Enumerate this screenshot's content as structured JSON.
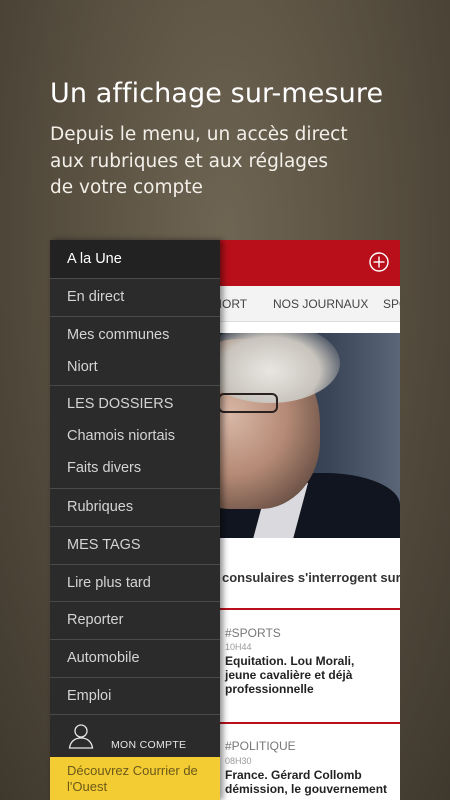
{
  "promo": {
    "title": "Un affichage sur-mesure",
    "subtitle_lines": [
      "Depuis le menu, un accès direct",
      "aux rubriques et aux réglages",
      "de votre compte"
    ]
  },
  "app": {
    "tabs": [
      "NIORT",
      "NOS JOURNAUX",
      "SPO"
    ],
    "lead_story": "consulaires s'interrogent sur",
    "cards": [
      {
        "tag": "#SPORTS",
        "time": "10H44",
        "title_lines": [
          "Equitation. Lou Morali,",
          "jeune cavalière et déjà",
          "professionnelle"
        ]
      },
      {
        "tag": "#POLITIQUE",
        "time": "08H30",
        "title_lines": [
          "France. Gérard Collomb",
          "démission, le gouvernement"
        ]
      }
    ],
    "colors": {
      "header": "#b90f1a",
      "drawer": "#2b2b2b",
      "cta": "#f3cb32"
    },
    "header_icon": "plus-circle-icon"
  },
  "drawer": {
    "items": [
      {
        "label": "A la Une",
        "active": true
      },
      {
        "label": "En direct"
      },
      {
        "label": "Mes communes"
      },
      {
        "label": "Niort"
      },
      {
        "label": "LES DOSSIERS"
      },
      {
        "label": "Chamois niortais"
      },
      {
        "label": "Faits divers"
      },
      {
        "label": "Rubriques"
      },
      {
        "label": "MES TAGS"
      },
      {
        "label": "Lire plus tard"
      },
      {
        "label": "Reporter"
      },
      {
        "label": "Automobile"
      },
      {
        "label": "Emploi"
      }
    ],
    "account_label": "MON COMPTE",
    "account_icon": "user-icon",
    "cta_lines": [
      "Découvrez Courrier de",
      "l'Ouest"
    ]
  }
}
